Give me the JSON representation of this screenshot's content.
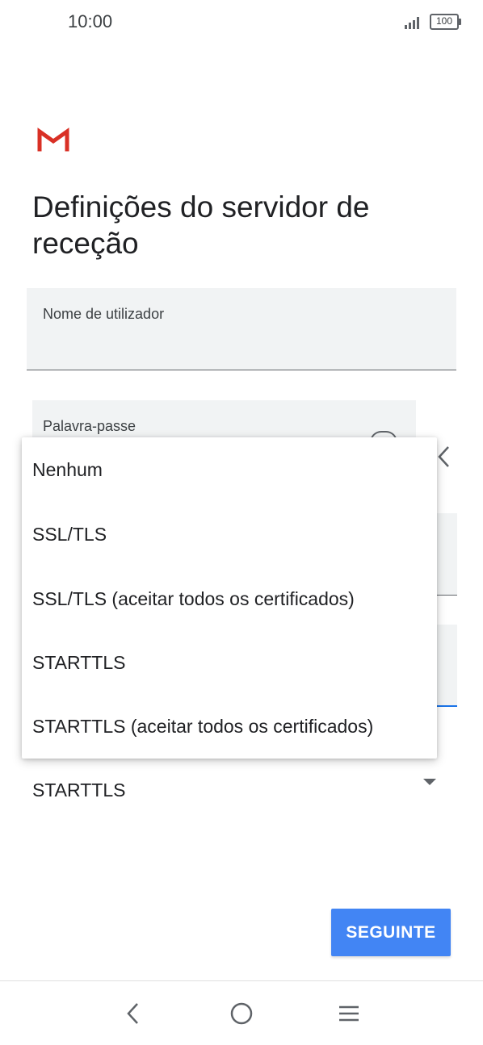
{
  "status_bar": {
    "time": "10:00",
    "battery": "100"
  },
  "icons": {
    "logo": "gmail-logo",
    "password_toggle": "eye-icon",
    "back": "chevron-back-icon",
    "dropdown_arrow": "dropdown-arrow-icon",
    "nav_back": "back-icon",
    "nav_home": "home-icon",
    "nav_menu": "menu-icon"
  },
  "colors": {
    "accent": "#4285f4",
    "focus_underline": "#1a73e8",
    "gmail_red": "#d93025"
  },
  "page": {
    "title": "Definições do servidor de receção"
  },
  "form": {
    "username_label": "Nome de utilizador",
    "password_label": "Palavra-passe",
    "security_type_value": "STARTTLS"
  },
  "dropdown": {
    "options": [
      "Nenhum",
      "SSL/TLS",
      "SSL/TLS (aceitar todos os certificados)",
      "STARTTLS",
      "STARTTLS (aceitar todos os certificados)"
    ]
  },
  "actions": {
    "next_label": "SEGUINTE"
  }
}
